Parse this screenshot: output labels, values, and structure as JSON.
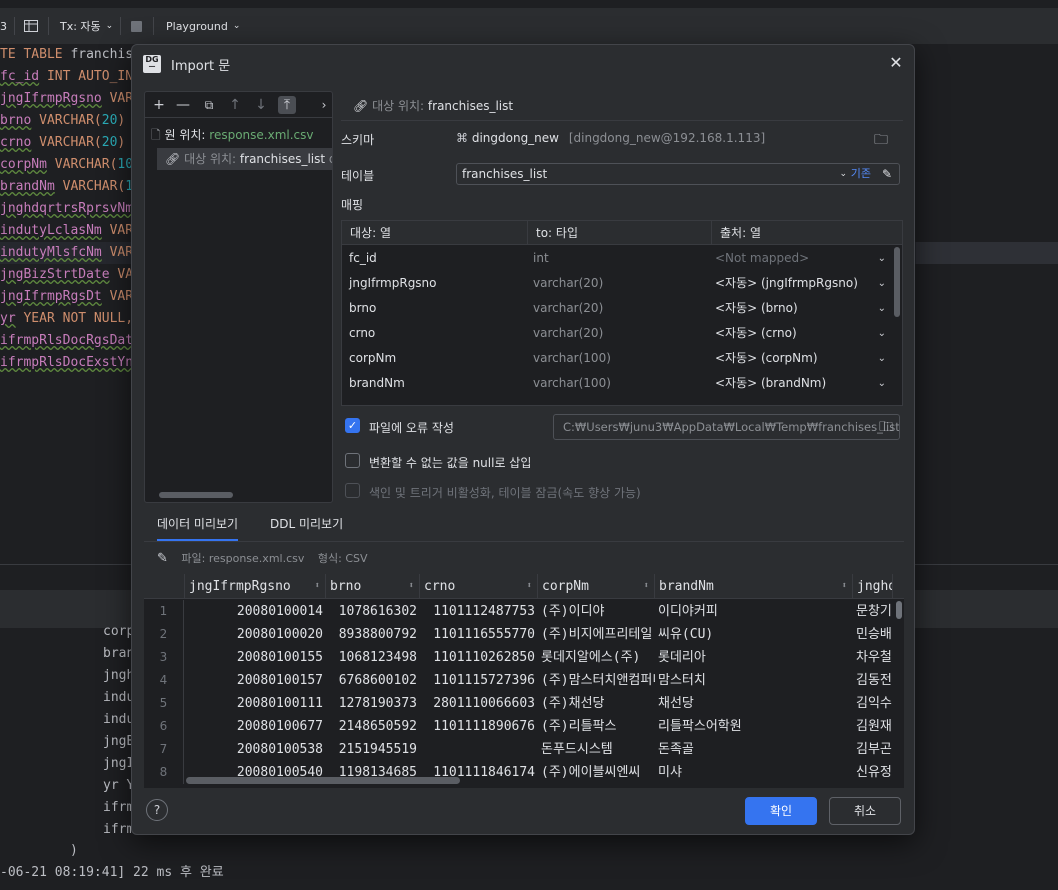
{
  "toolbar": {
    "tx_label": "Tx: 자동",
    "playground_label": "Playground"
  },
  "editor": {
    "lines": [
      {
        "kw": "TE TABLE ",
        "rest": "franchis"
      },
      {
        "fld": "fc_id",
        "kw": " INT AUTO_IN"
      },
      {
        "fld": "jngIfrmpRgsno",
        "kw": " VAR"
      },
      {
        "fld": "brno",
        "kw": " VARCHAR(",
        "num": "20",
        "tail": ")"
      },
      {
        "fld": "crno",
        "kw": " VARCHAR(",
        "num": "20",
        "tail": ")"
      },
      {
        "fld": "corpNm",
        "kw": " VARCHAR(",
        "num": "10"
      },
      {
        "fld": "brandNm",
        "kw": " VARCHAR(",
        "num": "1"
      },
      {
        "fld": "jnghdqrtrsRprsvNm",
        "kw": ""
      },
      {
        "fld": "indutyLclasNm",
        "kw": " VAR"
      },
      {
        "fld": "indutyMlsfcNm",
        "kw": " VAR"
      },
      {
        "fld": "jngBizStrtDate",
        "kw": " VA"
      },
      {
        "fld": "jngIfrmpRgsDt",
        "kw": " VAR"
      },
      {
        "fld": "yr",
        "kw": " YEAR NOT NULL,"
      },
      {
        "fld": "ifrmpRlsDocRgsDat",
        "kw": ""
      },
      {
        "fld": "ifrmpRlsDocExstYn",
        "kw": ""
      }
    ]
  },
  "output": {
    "lines": [
      "corp",
      "bran",
      "jngh",
      "indu",
      "indu",
      "jngB",
      "jngI",
      "yr Y",
      "ifrm",
      "ifrm"
    ],
    "close_paren": ")",
    "status": "-06-21 08:19:41] 22 ms 후 완료"
  },
  "dialog": {
    "title": "Import 문",
    "logo": "DG",
    "left_panel": {
      "source_label": "원 위치:",
      "source_value": "response.xml.csv",
      "target_label": "대상 위치:",
      "target_value": "franchises_list",
      "target_suffix": "di"
    },
    "right_header": {
      "label": "대상 위치:",
      "value": "franchises_list"
    },
    "schema": {
      "label": "스키마",
      "value": "dingdong_new",
      "host": "[dingdong_new@192.168.1.113]"
    },
    "table": {
      "label": "테이블",
      "value": "franchises_list",
      "basis_link": "기존"
    },
    "mapping": {
      "label": "매핑",
      "headers": [
        "대상: 열",
        "to: 타입",
        "출처: 열"
      ],
      "rows": [
        {
          "col": "fc_id",
          "type": "int",
          "source": "<Not mapped>",
          "muted": true
        },
        {
          "col": "jngIfrmpRgsno",
          "type": "varchar(20)",
          "source": "<자동> (jngIfrmpRgsno)"
        },
        {
          "col": "brno",
          "type": "varchar(20)",
          "source": "<자동> (brno)"
        },
        {
          "col": "crno",
          "type": "varchar(20)",
          "source": "<자동> (crno)"
        },
        {
          "col": "corpNm",
          "type": "varchar(100)",
          "source": "<자동> (corpNm)"
        },
        {
          "col": "brandNm",
          "type": "varchar(100)",
          "source": "<자동> (brandNm)"
        }
      ]
    },
    "options": {
      "write_errors_label": "파일에 오류 작성",
      "write_errors_checked": true,
      "error_path": "C:₩Users₩junu3₩AppData₩Local₩Temp₩franchises_list.t",
      "null_label": "변환할 수 없는 값을 null로 삽입",
      "null_checked": false,
      "disable_label": "색인 및 트리거 비활성화, 테이블 잠금(속도 향상 가능)",
      "disable_checked": false
    },
    "tabs": [
      "데이터 미리보기",
      "DDL 미리보기"
    ],
    "file_info": {
      "file_label": "파일: response.xml.csv",
      "format_label": "형식: CSV"
    },
    "preview": {
      "headers": [
        "jngIfrmpRgsno",
        "brno",
        "crno",
        "corpNm",
        "brandNm",
        "jnghd"
      ],
      "rows": [
        [
          "1",
          "20080100014",
          "1078616302",
          "1101112487753",
          "(주)이디야",
          "이디야커피",
          "문창기"
        ],
        [
          "2",
          "20080100020",
          "8938800792",
          "1101116555770",
          "(주)비지에프리테일",
          "씨유(CU)",
          "민승배"
        ],
        [
          "3",
          "20080100155",
          "1068123498",
          "1101110262850",
          "롯데지알에스(주)",
          "롯데리아",
          "차우철"
        ],
        [
          "4",
          "20080100157",
          "6768600102",
          "1101115727396",
          "(주)맘스터치앤컴퍼니",
          "맘스터치",
          "김동전"
        ],
        [
          "5",
          "20080100111",
          "1278190373",
          "2801110066603",
          "(주)채선당",
          "채선당",
          "김익수"
        ],
        [
          "6",
          "20080100677",
          "2148650592",
          "1101111890676",
          "(주)리틀팍스",
          "리틀팍스어학원",
          "김원재"
        ],
        [
          "7",
          "20080100538",
          "2151945519",
          "",
          "돈푸드시스템",
          "돈족골",
          "김부곤"
        ],
        [
          "8",
          "20080100540",
          "1198134685",
          "1101111846174",
          "(주)에이블씨엔씨",
          "미샤",
          "신유정"
        ]
      ]
    },
    "buttons": {
      "ok": "확인",
      "cancel": "취소",
      "help": "?"
    }
  }
}
